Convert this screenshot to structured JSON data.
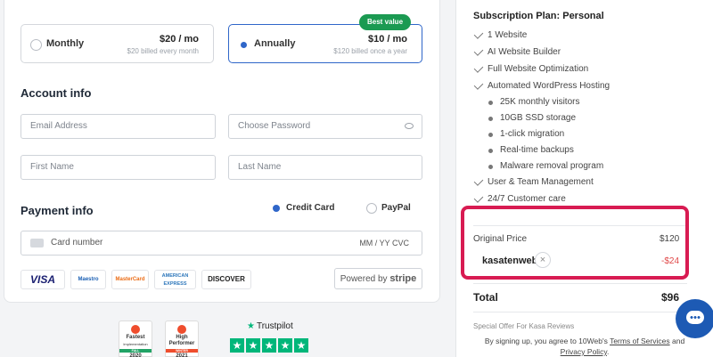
{
  "plans": {
    "monthly": {
      "label": "Monthly",
      "price": "$20 / mo",
      "billed": "$20 billed every month"
    },
    "annually": {
      "label": "Annually",
      "price": "$10 / mo",
      "billed": "$120 billed once a year",
      "badge": "Best value"
    }
  },
  "account": {
    "title": "Account info",
    "email_placeholder": "Email Address",
    "password_placeholder": "Choose Password",
    "first_name_placeholder": "First Name",
    "last_name_placeholder": "Last Name"
  },
  "payment": {
    "title": "Payment info",
    "credit_card": "Credit Card",
    "paypal": "PayPal",
    "card_number": "Card number",
    "expiry_cvc": "MM / YY  CVC",
    "powered_prefix": "Powered by",
    "powered_brand": "stripe",
    "card_logos": [
      "VISA",
      "Maestro",
      "MasterCard",
      "AMERICAN EXPRESS",
      "DISCOVER"
    ]
  },
  "badges": {
    "g2_fastest": [
      "Fastest",
      "Implementation",
      "FALL",
      "2020"
    ],
    "g2_high": [
      "High",
      "Performer",
      "WINTER",
      "2021"
    ],
    "trustpilot": "Trustpilot"
  },
  "summary": {
    "title": "Subscription Plan: Personal",
    "features": [
      "1 Website",
      "AI Website Builder",
      "Full Website Optimization",
      "Automated WordPress Hosting"
    ],
    "sub_features": [
      "25K monthly visitors",
      "10GB SSD storage",
      "1-click migration",
      "Real-time backups",
      "Malware removal program"
    ],
    "more_features": [
      "User & Team Management",
      "24/7 Customer care"
    ],
    "original_price_label": "Original Price",
    "original_price": "$120",
    "coupon": "kasatenweb",
    "discount": "-$24",
    "total_label": "Total",
    "total_value": "$96",
    "offer": "Special Offer For Kasa Reviews",
    "terms_prefix": "By signing up, you agree to 10Web's",
    "terms_link": "Terms of Services",
    "terms_and": "and",
    "privacy_link": "Privacy Policy",
    "terms_end": "."
  },
  "colors": {
    "accent": "#2f66c9",
    "badge": "#1b9a52",
    "highlight": "#d81b52",
    "trustpilot": "#00b67a",
    "chat": "#1d5ab4"
  }
}
